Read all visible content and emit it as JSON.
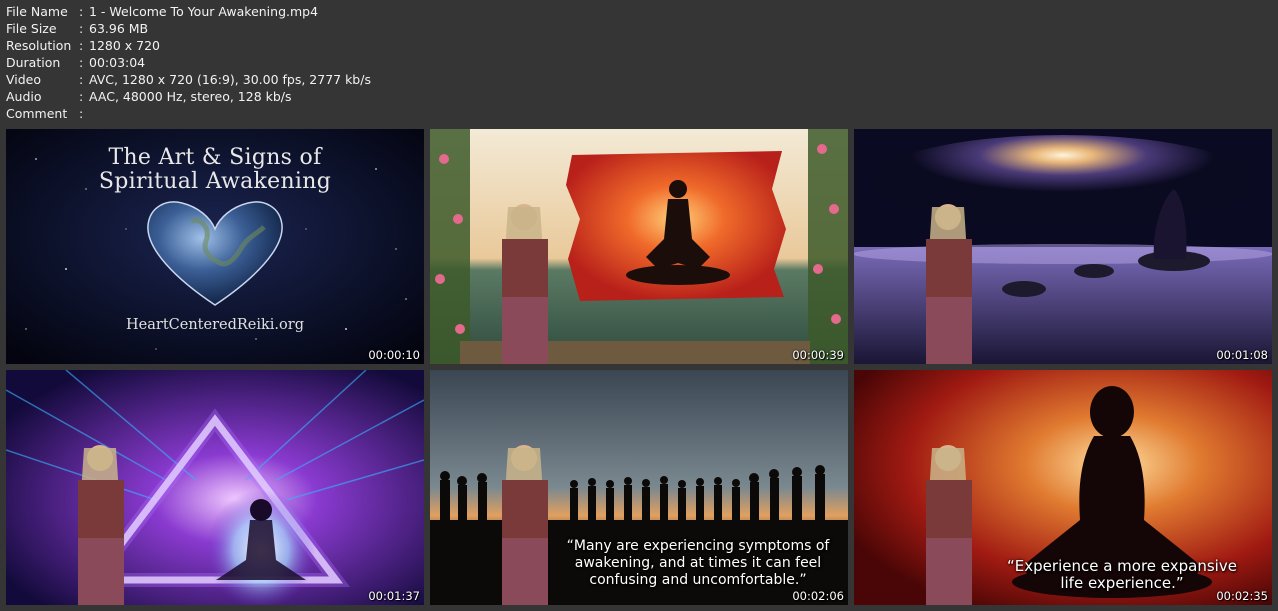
{
  "file_info": {
    "rows": [
      {
        "key": "File Name",
        "sep": ":",
        "value": "1 - Welcome To Your Awakening.mp4"
      },
      {
        "key": "File Size",
        "sep": ":",
        "value": "63.96 MB"
      },
      {
        "key": "Resolution",
        "sep": ":",
        "value": "1280 x 720"
      },
      {
        "key": "Duration",
        "sep": ":",
        "value": "00:03:04"
      },
      {
        "key": "Video",
        "sep": ":",
        "value": "AVC, 1280 x 720 (16:9), 30.00 fps, 2777 kb/s"
      },
      {
        "key": "Audio",
        "sep": ":",
        "value": "AAC, 48000 Hz, stereo, 128 kb/s"
      },
      {
        "key": "Comment",
        "sep": ":",
        "value": ""
      }
    ]
  },
  "thumbnails": [
    {
      "timestamp": "00:00:10",
      "title_line1": "The Art & Signs of",
      "title_line2": "Spiritual Awakening",
      "site": "HeartCenteredReiki.org"
    },
    {
      "timestamp": "00:00:39"
    },
    {
      "timestamp": "00:01:08"
    },
    {
      "timestamp": "00:01:37"
    },
    {
      "timestamp": "00:02:06",
      "caption_line1": "“Many are experiencing symptoms of",
      "caption_line2": "awakening, and at times it can feel",
      "caption_line3": "confusing and uncomfortable.”"
    },
    {
      "timestamp": "00:02:35",
      "caption_line1": "“Experience a more expansive",
      "caption_line2": "life experience.”"
    }
  ],
  "colors": {
    "background": "#353535",
    "text": "#f2f2f2"
  }
}
